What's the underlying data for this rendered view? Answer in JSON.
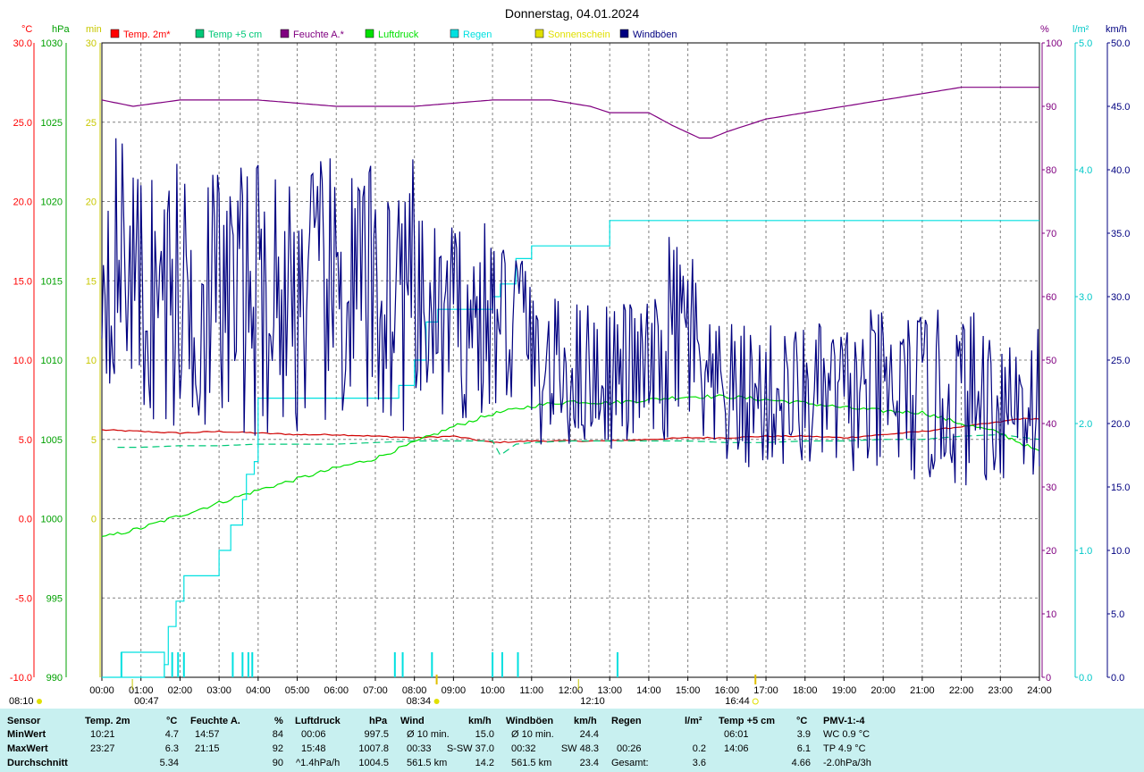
{
  "chart_data": {
    "type": "line",
    "title": "Donnerstag, 04.01.2024",
    "x_ticks": [
      "00:00",
      "01:00",
      "02:00",
      "03:00",
      "04:00",
      "05:00",
      "06:00",
      "07:00",
      "08:00",
      "09:00",
      "10:00",
      "11:00",
      "12:00",
      "13:00",
      "14:00",
      "15:00",
      "16:00",
      "17:00",
      "18:00",
      "19:00",
      "20:00",
      "21:00",
      "22:00",
      "23:00",
      "24:00"
    ],
    "axes": {
      "temp": {
        "unit": "°C",
        "color": "#ff0000",
        "min": -10,
        "max": 30,
        "ticks": [
          "30.0",
          "25.0",
          "20.0",
          "15.0",
          "10.0",
          "5.0",
          "0.0",
          "-5.0",
          "-10.0"
        ]
      },
      "hpa": {
        "unit": "hPa",
        "color": "#00a000",
        "min": 990,
        "max": 1030,
        "ticks": [
          "1030",
          "1025",
          "1020",
          "1015",
          "1010",
          "1005",
          "1000",
          "995",
          "990"
        ]
      },
      "min": {
        "unit": "min",
        "color": "#c8c800",
        "ticks": [
          "30",
          "25",
          "20",
          "15",
          "10",
          "5",
          "0"
        ]
      },
      "pct": {
        "unit": "%",
        "color": "#800080",
        "min": 0,
        "max": 100,
        "ticks": [
          "100",
          "90",
          "80",
          "70",
          "60",
          "50",
          "40",
          "30",
          "20",
          "10",
          "0"
        ]
      },
      "rain": {
        "unit": "l/m²",
        "color": "#00c8c8",
        "min": 0,
        "max": 5,
        "ticks": [
          "5.0",
          "4.0",
          "3.0",
          "2.0",
          "1.0",
          "0.0"
        ]
      },
      "wind": {
        "unit": "km/h",
        "color": "#000080",
        "min": 0,
        "max": 50,
        "ticks": [
          "50.0",
          "45.0",
          "40.0",
          "35.0",
          "30.0",
          "25.0",
          "20.0",
          "15.0",
          "10.0",
          "5.0",
          "0.0"
        ]
      }
    },
    "legend": [
      {
        "label": "Temp. 2m*",
        "color": "#ff0000"
      },
      {
        "label": "Temp +5 cm",
        "color": "#00c878"
      },
      {
        "label": "Feuchte A.*",
        "color": "#800080"
      },
      {
        "label": "Luftdruck",
        "color": "#00e000"
      },
      {
        "label": "Regen",
        "color": "#00e0e0"
      },
      {
        "label": "Sonnenschein",
        "color": "#e0e000"
      },
      {
        "label": "Windböen",
        "color": "#000080"
      }
    ],
    "series": [
      {
        "name": "Temp. 2m*",
        "axis": "temp",
        "x": [
          0,
          1,
          2,
          3,
          4,
          5,
          6,
          7,
          8,
          9,
          10,
          11,
          12,
          13,
          14,
          15,
          16,
          17,
          18,
          19,
          20,
          21,
          22,
          23,
          23.45,
          24
        ],
        "values": [
          5.6,
          5.5,
          5.4,
          5.5,
          5.4,
          5.3,
          5.3,
          5.2,
          5.1,
          5.2,
          4.8,
          4.9,
          4.9,
          4.9,
          5.0,
          5.1,
          5.1,
          5.2,
          5.2,
          5.1,
          5.3,
          5.5,
          5.8,
          6.1,
          6.3,
          6.3
        ]
      },
      {
        "name": "Temp +5 cm",
        "axis": "temp",
        "x": [
          0.4,
          1,
          2,
          3,
          4,
          5,
          6,
          7,
          8,
          9,
          10,
          10.2,
          10.6,
          11,
          12,
          13,
          14,
          15,
          16,
          17,
          18,
          19,
          20,
          21,
          22,
          23,
          24
        ],
        "values": [
          4.5,
          4.5,
          4.6,
          4.6,
          4.7,
          4.7,
          4.7,
          4.8,
          4.9,
          4.9,
          4.9,
          4.0,
          4.7,
          4.8,
          4.9,
          4.9,
          4.9,
          4.9,
          4.8,
          4.8,
          4.9,
          4.9,
          5.0,
          5.0,
          5.2,
          5.3,
          5.0
        ]
      },
      {
        "name": "Feuchte A.*",
        "axis": "pct",
        "x": [
          0,
          0.8,
          2,
          4,
          6,
          8,
          10,
          11.5,
          12.5,
          13,
          14,
          14.6,
          15.3,
          15.6,
          16,
          17,
          18,
          19,
          20,
          21,
          22,
          23,
          24
        ],
        "values": [
          91,
          90,
          91,
          91,
          90,
          90,
          91,
          91,
          90,
          89,
          89,
          87,
          85,
          85,
          86,
          88,
          89,
          90,
          91,
          92,
          93,
          93,
          93
        ]
      },
      {
        "name": "Luftdruck",
        "axis": "hpa",
        "x": [
          0,
          1,
          2,
          3,
          4,
          5,
          6,
          7,
          8,
          9,
          10,
          11,
          12,
          13,
          14,
          15,
          16,
          17,
          18,
          19,
          20,
          21,
          22,
          23,
          24
        ],
        "values": [
          998.8,
          999.4,
          1000.2,
          1001.0,
          1001.8,
          1002.5,
          1003.2,
          1003.8,
          1004.8,
          1005.8,
          1006.6,
          1007.1,
          1007.4,
          1007.3,
          1007.5,
          1007.7,
          1007.7,
          1007.5,
          1007.3,
          1007.0,
          1006.8,
          1006.7,
          1006.0,
          1005.4,
          1004.2
        ]
      },
      {
        "name": "Regen",
        "axis": "rain",
        "x": [
          0,
          1.6,
          1.7,
          1.9,
          2.1,
          3.0,
          3.3,
          3.6,
          3.7,
          3.9,
          4.0,
          7.6,
          8.0,
          8.3,
          8.6,
          10.0,
          10.2,
          10.6,
          11.0,
          12.5,
          13.0,
          16.0,
          24.0
        ],
        "values": [
          0.0,
          0.1,
          0.4,
          0.6,
          0.8,
          1.0,
          1.2,
          1.4,
          1.6,
          1.7,
          2.2,
          2.3,
          2.5,
          2.8,
          2.9,
          3.0,
          3.1,
          3.3,
          3.4,
          3.4,
          3.6,
          3.6,
          3.6
        ]
      },
      {
        "name": "Windböen",
        "axis": "wind"
      }
    ],
    "rain_ticks_x": [
      0.5,
      1.8,
      1.95,
      2.1,
      3.35,
      3.6,
      3.75,
      3.85,
      7.5,
      7.7,
      8.45,
      10.0,
      10.25,
      10.65,
      13.2
    ],
    "sun_markers": [
      {
        "x": 8.57
      },
      {
        "x": 16.73
      }
    ],
    "sunrise_label": "08:34",
    "sunset_label": "16:44",
    "sun_min_label": "08:10",
    "markers": [
      {
        "x": 0.78,
        "label": "00:47"
      },
      {
        "x": 12.2,
        "label": "12:10"
      }
    ]
  },
  "footer": {
    "col_sensor": [
      "Sensor",
      "MinWert",
      "MaxWert",
      "Durchschnitt"
    ],
    "temp2m": {
      "label": "Temp. 2m",
      "unit": "°C",
      "min_t": "10:21",
      "min_v": "4.7",
      "max_t": "23:27",
      "max_v": "6.3",
      "avg": "5.34"
    },
    "feuchte": {
      "label": "Feuchte A.",
      "unit": "%",
      "min_t": "14:57",
      "min_v": "84",
      "max_t": "21:15",
      "max_v": "92",
      "avg": "90"
    },
    "luft": {
      "label": "Luftdruck",
      "unit": "hPa",
      "min_t": "00:06",
      "min_v": "997.5",
      "max_t": "15:48",
      "max_v": "1007.8",
      "trend": "^1.4hPa/h",
      "avg": "1004.5"
    },
    "wind": {
      "label": "Wind",
      "unit": "km/h",
      "r1a": "Ø 10 min.",
      "r1b": "15.0",
      "r2a": "00:33",
      "r2b": "S-SW 37.0",
      "r3a": "561.5 km",
      "r3b": "14.2"
    },
    "boeen": {
      "label": "Windböen",
      "unit": "km/h",
      "r1a": "Ø 10 min.",
      "r1b": "24.4",
      "r2a": "00:32",
      "r2b": "SW 48.3",
      "r3a": "561.5 km",
      "r3b": "23.4"
    },
    "regen": {
      "label": "Regen",
      "unit": "l/m²",
      "r2a": "00:26",
      "r2b": "0.2",
      "r3a": "Gesamt:",
      "r3b": "3.6"
    },
    "temp5": {
      "label": "Temp +5 cm",
      "unit": "°C",
      "min_t": "06:01",
      "min_v": "3.9",
      "max_t": "14:06",
      "max_v": "6.1",
      "avg": "4.66"
    },
    "pmv": {
      "label": "PMV-1:-4",
      "wc": "WC 0.9 °C",
      "tp": "TP 4.9 °C",
      "trend": "-2.0hPa/3h"
    }
  }
}
